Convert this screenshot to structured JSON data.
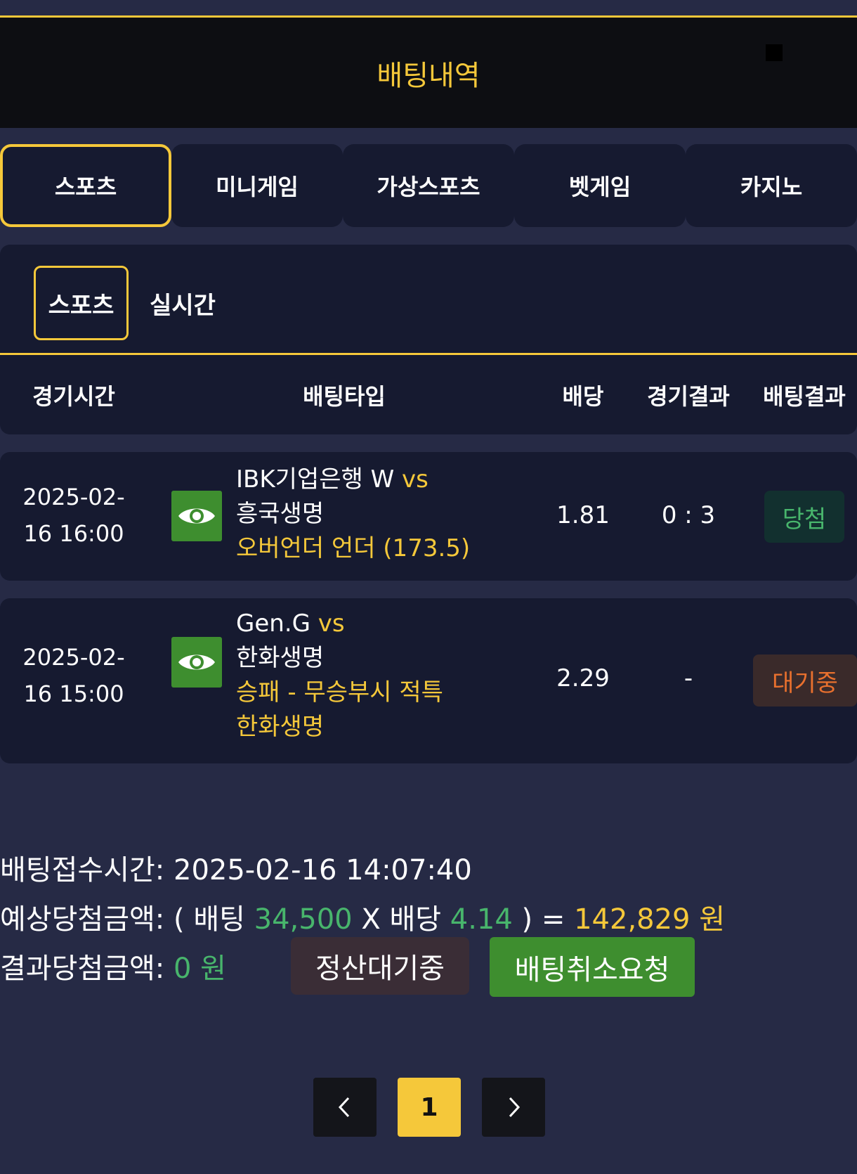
{
  "header": {
    "title": "배팅내역",
    "close_icon": "close-icon"
  },
  "tabs": [
    {
      "label": "스포츠",
      "active": true
    },
    {
      "label": "미니게임",
      "active": false
    },
    {
      "label": "가상스포츠",
      "active": false
    },
    {
      "label": "벳게임",
      "active": false
    },
    {
      "label": "카지노",
      "active": false
    }
  ],
  "subtabs": [
    {
      "label": "스포츠",
      "active": true
    },
    {
      "label": "실시간",
      "active": false
    }
  ],
  "table": {
    "headers": {
      "time": "경기시간",
      "type": "배팅타입",
      "odds": "배당",
      "game_result": "경기결과",
      "bet_result": "배팅결과"
    },
    "rows": [
      {
        "time_line1": "2025-02-",
        "time_line2": "16 16:00",
        "team1": "IBK기업은행 W",
        "vs": "vs",
        "team2": "흥국생명",
        "pick_line1": "오버언더 언더 (173.5)",
        "pick_line2": "",
        "odds": "1.81",
        "game_result": "0 : 3",
        "bet_result": "당첨",
        "bet_result_color": "#48b56c"
      },
      {
        "time_line1": "2025-02-",
        "time_line2": "16 15:00",
        "team1": "Gen.G",
        "vs": "vs",
        "team2": "한화생명",
        "pick_line1": "승패 - 무승부시 적특",
        "pick_line2": "한화생명",
        "odds": "2.29",
        "game_result": "-",
        "bet_result": "대기중",
        "bet_result_color": "#e8702e"
      }
    ]
  },
  "summary": {
    "received_label": "배팅접수시간: ",
    "received_value": "2025-02-16 14:07:40",
    "expected_label": "예상당첨금액: ",
    "expected_open": "( 배팅 ",
    "bet_amount": "34,500",
    "times": " X 배당 ",
    "total_odds": "4.14",
    "close_eq": " ) = ",
    "expected_amount": "142,829 원",
    "result_label": "결과당첨금액: ",
    "result_amount": "0 원",
    "settle_status": "정산대기중",
    "cancel_button": "배팅취소요청"
  },
  "pagination": {
    "prev": "‹",
    "current": "1",
    "next": "›"
  },
  "colors": {
    "accent": "#f5c83a",
    "win": "#48b56c",
    "pending": "#e8702e",
    "button_green": "#3e8e2f"
  }
}
